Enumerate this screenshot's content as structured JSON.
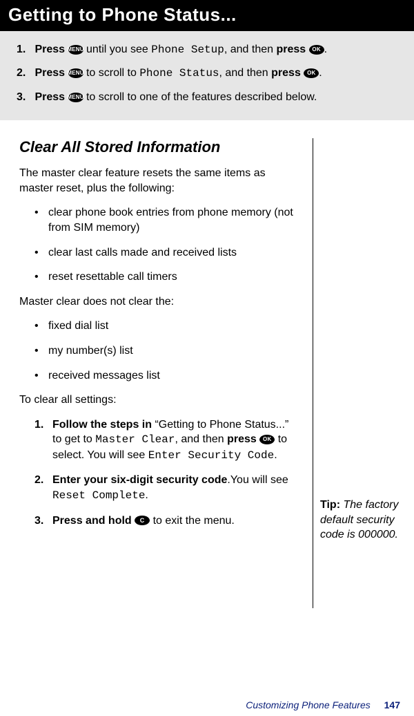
{
  "header_title": "Getting to Phone Status...",
  "steps_top": [
    {
      "num": "1.",
      "pre": "Press ",
      "btn1": "MENU",
      "mid1": " until you see ",
      "lcd1": "Phone Setup",
      "mid2": ", and then ",
      "bold2": "press ",
      "btn2": "OK",
      "end": "."
    },
    {
      "num": "2.",
      "pre": "Press ",
      "btn1": "MENU",
      "mid1": " to scroll to ",
      "lcd1": "Phone Status",
      "mid2": ", and then ",
      "bold2": "press ",
      "btn2": "OK",
      "end": "."
    },
    {
      "num": "3.",
      "pre": "Press ",
      "btn1": "MENU",
      "mid1": " to scroll to one of the features described below.",
      "lcd1": "",
      "mid2": "",
      "bold2": "",
      "btn2": "",
      "end": ""
    }
  ],
  "section_heading": "Clear All Stored Information",
  "intro_para": "The master clear feature resets the same items as master reset, plus the following:",
  "bullets1": [
    "clear phone book entries from phone memory (not from SIM memory)",
    "clear last calls made and received lists",
    "reset resettable call timers"
  ],
  "mid_para": "Master clear does not clear the:",
  "bullets2": [
    "fixed dial list",
    "my number(s) list",
    "received messages list"
  ],
  "clear_para": "To clear all settings:",
  "steps_bottom": {
    "s1": {
      "num": "1.",
      "bold": "Follow the steps in",
      "text1": " “Getting to Phone Status...” to get to ",
      "lcd1": "Master Clear",
      "text2": ", and then ",
      "bold2": "press ",
      "btn": "OK",
      "text3": " to select. You will see ",
      "lcd2": "Enter Security Code",
      "text4": "."
    },
    "s2": {
      "num": "2.",
      "bold": "Enter your six-digit security code",
      "text1": ".You will see ",
      "lcd1": "Reset Complete",
      "text2": "."
    },
    "s3": {
      "num": "3.",
      "bold": "Press and hold ",
      "btn": "C",
      "text1": " to exit the menu."
    }
  },
  "tip": {
    "label": "Tip:",
    "text": " The factory default security code is 000000."
  },
  "footer_section": "Customizing Phone Features",
  "footer_page": "147"
}
